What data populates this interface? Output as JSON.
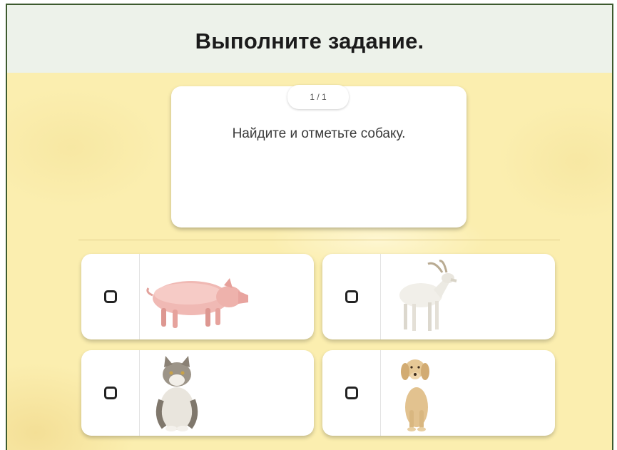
{
  "header": {
    "title": "Выполните задание."
  },
  "task": {
    "counter": "1 / 1",
    "instruction": "Найдите и отметьте собаку."
  },
  "options": [
    {
      "animal": "pig",
      "checked": false
    },
    {
      "animal": "goat",
      "checked": false
    },
    {
      "animal": "cat",
      "checked": false
    },
    {
      "animal": "dog",
      "checked": false
    }
  ],
  "colors": {
    "background": "#fbeeaf",
    "header_bg": "#edf2ea",
    "frame_border": "#3d5a2e",
    "card_bg": "#ffffff"
  }
}
